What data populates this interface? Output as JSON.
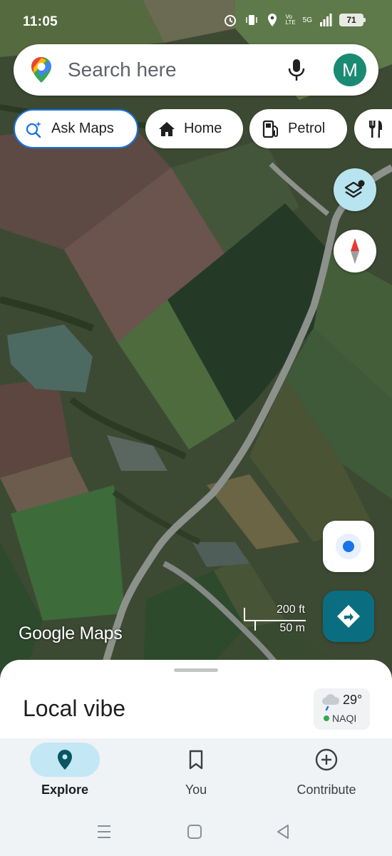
{
  "status_bar": {
    "time": "11:05",
    "network_label": "5G",
    "volte_label": "Vo LTE",
    "battery": "71"
  },
  "search": {
    "placeholder": "Search here",
    "avatar_initial": "M"
  },
  "chips": [
    {
      "label": "Ask Maps",
      "icon": "sparkle-search-icon"
    },
    {
      "label": "Home",
      "icon": "home-icon"
    },
    {
      "label": "Petrol",
      "icon": "fuel-pump-icon"
    },
    {
      "label": "",
      "icon": "restaurant-icon"
    }
  ],
  "map": {
    "watermark": "Google Maps",
    "scale_imperial": "200 ft",
    "scale_metric": "50 m",
    "type": "satellite"
  },
  "sheet": {
    "title": "Local vibe",
    "weather_temp": "29°",
    "weather_aqi": "NAQI"
  },
  "nav": [
    {
      "label": "Explore",
      "icon": "location-pin-icon",
      "active": true
    },
    {
      "label": "You",
      "icon": "bookmark-icon",
      "active": false
    },
    {
      "label": "Contribute",
      "icon": "add-circle-icon",
      "active": false
    }
  ],
  "colors": {
    "accent": "#1a73e8",
    "avatar": "#1a8a73",
    "directions": "#0b6e80",
    "layers": "#b8e4ef",
    "nav_active": "#c3e7f5"
  }
}
